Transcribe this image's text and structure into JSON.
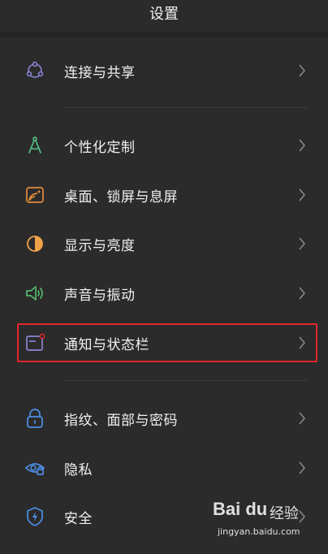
{
  "header": {
    "title": "设置"
  },
  "items": [
    {
      "label": "连接与共享",
      "icon": "share-network-icon",
      "color": "#8a85d6"
    },
    {
      "label": "个性化定制",
      "icon": "compass-icon",
      "color": "#54b884"
    },
    {
      "label": "桌面、锁屏与息屏",
      "icon": "wallpaper-icon",
      "color": "#e38a3a"
    },
    {
      "label": "显示与亮度",
      "icon": "brightness-icon",
      "color": "#f0a24a"
    },
    {
      "label": "声音与振动",
      "icon": "speaker-icon",
      "color": "#57b56a"
    },
    {
      "label": "通知与状态栏",
      "icon": "notification-icon",
      "color": "#8a85d6"
    },
    {
      "label": "指纹、面部与密码",
      "icon": "lock-icon",
      "color": "#4d8fe6"
    },
    {
      "label": "隐私",
      "icon": "privacy-eye-icon",
      "color": "#4d8fe6"
    },
    {
      "label": "安全",
      "icon": "shield-icon",
      "color": "#4d8fe6"
    }
  ],
  "highlight_color": "#e3262b",
  "watermark": {
    "brand": "Bai du",
    "cn": "经验",
    "url": "jingyan.baidu.com"
  }
}
